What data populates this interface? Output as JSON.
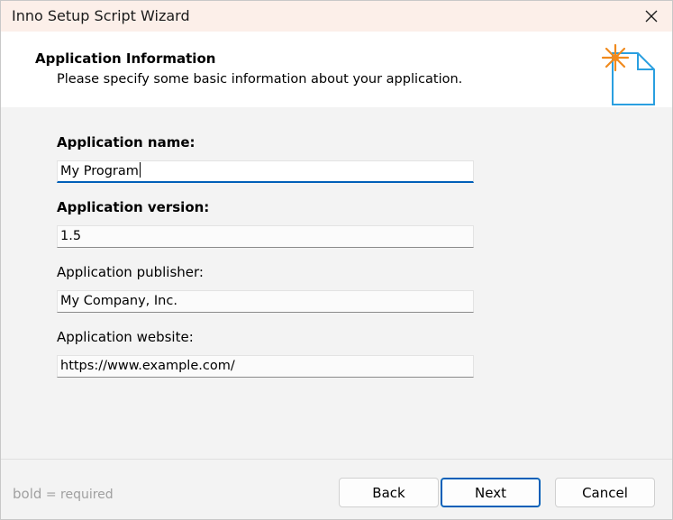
{
  "window": {
    "title": "Inno Setup Script Wizard"
  },
  "header": {
    "title": "Application Information",
    "description": "Please specify some basic information about your application."
  },
  "fields": [
    {
      "label": "Application name:",
      "value": "My Program",
      "required": true
    },
    {
      "label": "Application version:",
      "value": "1.5",
      "required": true
    },
    {
      "label": "Application publisher:",
      "value": "My Company, Inc.",
      "required": false
    },
    {
      "label": "Application website:",
      "value": "https://www.example.com/",
      "required": false
    }
  ],
  "footer": {
    "legend_bold": "bold",
    "legend_rest": " = required",
    "back_label": "Back",
    "next_label": "Next",
    "cancel_label": "Cancel"
  },
  "icons": {
    "close": "close-icon",
    "wizard": "wizard-document-icon"
  },
  "colors": {
    "titlebar_bg": "#fcefe9",
    "accent": "#005fb8",
    "spark": "#f08a1d",
    "icon_stroke": "#2a9fe0"
  }
}
